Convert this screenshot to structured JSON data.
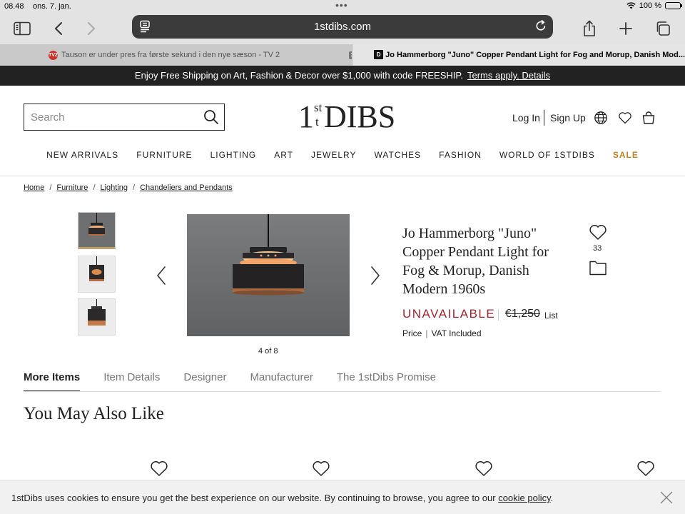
{
  "status": {
    "time": "08.48",
    "date": "ons. 7. jan.",
    "battery": "100 %",
    "battery_level_percent": 100
  },
  "browser": {
    "url": "1stdibs.com",
    "tabs": [
      {
        "title": "Tauson er under pres fra første sekund i den nye sæson - TV 2",
        "favicon": "TV2",
        "active": false
      },
      {
        "title": "Jo Hammerborg \"Juno\" Copper Pendant Light for Fog and Morup, Danish Mod...",
        "favicon": "D",
        "active": true
      }
    ]
  },
  "promo": {
    "text": "Enjoy Free Shipping on Art, Fashion & Decor over $1,000 with code FREESHIP.",
    "link": "Terms apply. Details"
  },
  "header": {
    "search_placeholder": "Search",
    "logo": {
      "one": "1",
      "st": "st",
      "t": "t",
      "dibs": "DIBS"
    },
    "login": "Log In",
    "signup": "Sign Up",
    "nav": [
      "NEW ARRIVALS",
      "FURNITURE",
      "LIGHTING",
      "ART",
      "JEWELRY",
      "WATCHES",
      "FASHION",
      "WORLD OF 1STDIBS"
    ],
    "sale": "SALE"
  },
  "breadcrumbs": [
    "Home",
    "Furniture",
    "Lighting",
    "Chandeliers and Pendants"
  ],
  "gallery": {
    "counter": "4 of 8"
  },
  "product": {
    "title": "Jo Hammerborg \"Juno\" Copper Pendant Light for Fog & Morup, Danish Modern 1960s",
    "status": "UNAVAILABLE",
    "old_price": "€1,250",
    "list_label": "List",
    "price_label": "Price",
    "vat": "VAT Included",
    "favorites": "33"
  },
  "detail_tabs": [
    "More Items",
    "Item Details",
    "Designer",
    "Manufacturer",
    "The 1stDibs Promise"
  ],
  "section_title": "You May Also Like",
  "cookie": {
    "text": "1stDibs uses cookies to ensure you get the best experience on our website. By continuing to browse, you agree to our",
    "link": "cookie policy",
    "end": "."
  },
  "colors": {
    "unavailable": "#a5232e",
    "sale": "#c2811f",
    "promo_bg": "#222222"
  },
  "icons": [
    "sidebar-icon",
    "back-icon",
    "forward-icon",
    "reader-icon",
    "reload-icon",
    "share-icon",
    "plus-icon",
    "tabs-icon",
    "search-icon",
    "globe-icon",
    "heart-icon",
    "bag-icon",
    "chevron-left-icon",
    "chevron-right-icon",
    "folder-icon",
    "close-icon"
  ]
}
